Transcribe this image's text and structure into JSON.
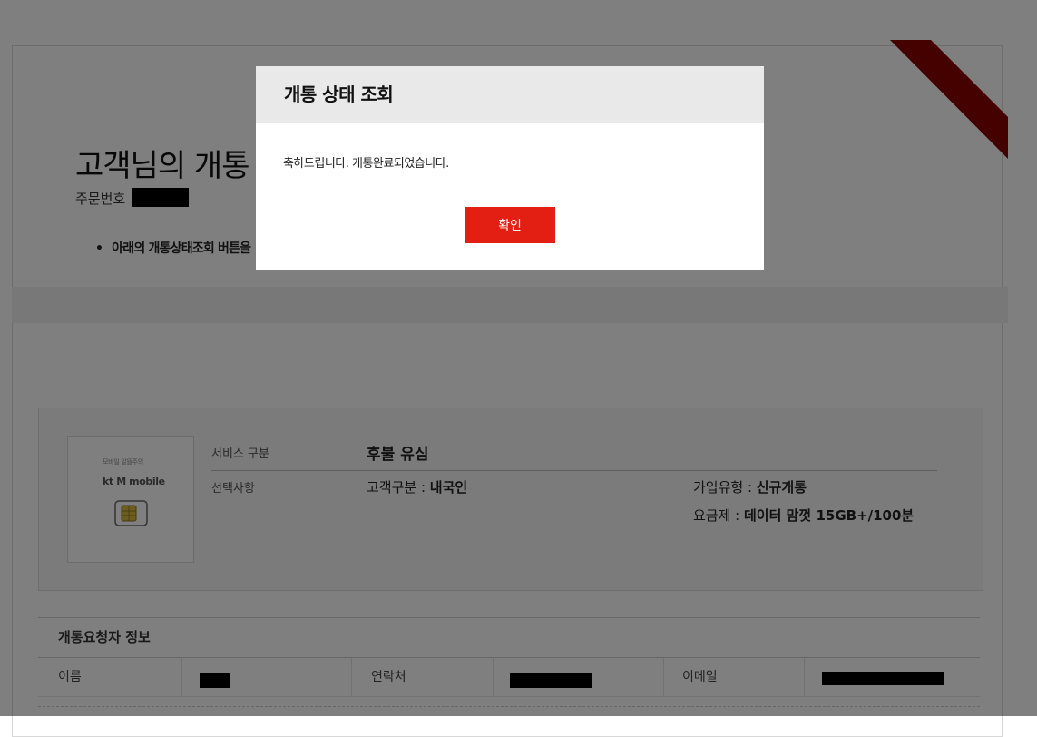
{
  "page": {
    "title": "고객님의 개통",
    "order_label": "주문번호",
    "notice": "아래의 개통상태조회 버튼을"
  },
  "product": {
    "thumb_tiny": "모바일 알뜰주의",
    "thumb_brand": "kt M mobile",
    "service_label": "서비스 구분",
    "service_value": "후불 유심",
    "options_label": "선택사항",
    "customer_type_label": "고객구분 : ",
    "customer_type_value": "내국인",
    "join_type_label": "가입유형 : ",
    "join_type_value": "신규개통",
    "plan_label": "요금제 : ",
    "plan_value": "데이터 맘껏 15GB+/100분"
  },
  "requester": {
    "heading": "개통요청자 정보",
    "name_label": "이름",
    "contact_label": "연락처",
    "email_label": "이메일"
  },
  "modal": {
    "title": "개통 상태 조회",
    "message": "축하드립니다. 개통완료되었습니다.",
    "confirm_label": "확인"
  },
  "colors": {
    "accent": "#e31e12",
    "ribbon": "#8b0000",
    "overlay": "rgba(0,0,0,0.5)"
  }
}
